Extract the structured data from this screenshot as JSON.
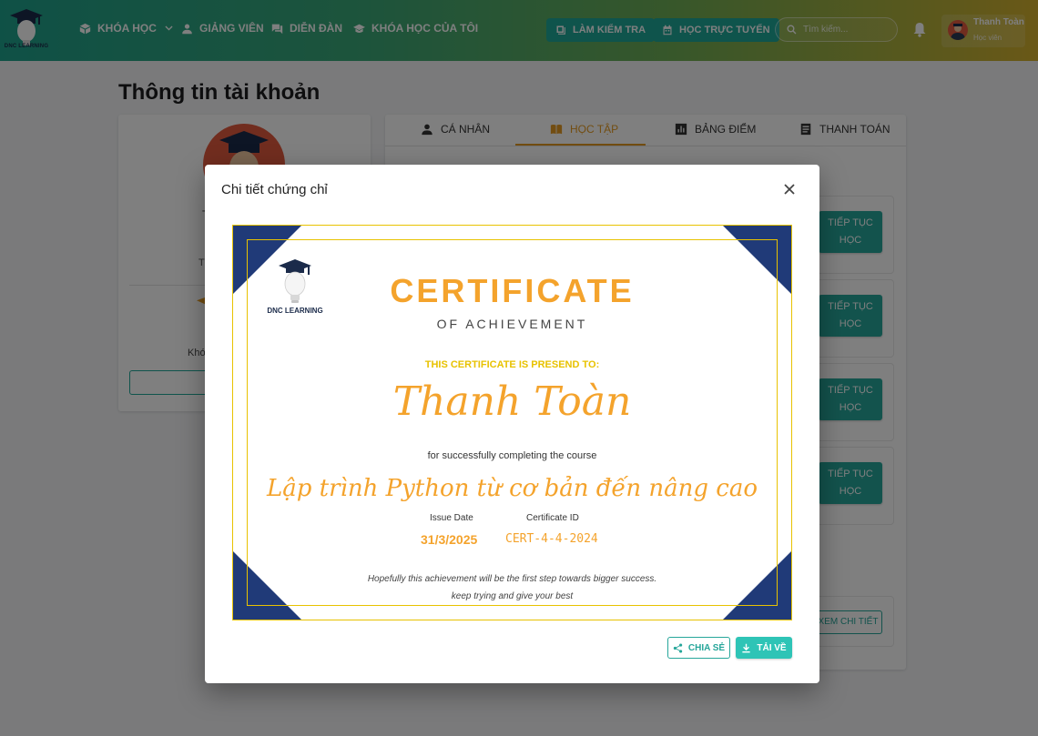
{
  "header": {
    "logo_text": "DNC LEARNING",
    "nav": {
      "courses": "KHÓA HỌC",
      "teachers": "GIẢNG VIÊN",
      "forum": "DIỄN ĐÀN",
      "my_courses": "KHÓA HỌC CỦA TÔI"
    },
    "test_button": "LÀM KIỂM TRA",
    "online_button": "HỌC TRỰC TUYẾN",
    "search_placeholder": "Tìm kiếm...",
    "user": {
      "name": "Thanh Toàn",
      "role": "Học viên"
    }
  },
  "page": {
    "title": "Thông tin tài khoản",
    "profile": {
      "name_fragment": "T",
      "role_fragment": "Th",
      "stat_fragment": "Khó"
    },
    "tabs": [
      {
        "label": "CÁ NHÂN",
        "icon": "person-icon"
      },
      {
        "label": "HỌC TẬP",
        "icon": "book-icon"
      },
      {
        "label": "BẢNG ĐIỂM",
        "icon": "bar-chart-icon"
      },
      {
        "label": "THANH TOÁN",
        "icon": "receipt-icon"
      }
    ],
    "continue_label": "TIẾP TỤC HỌC",
    "view_detail_label": "XEM CHI TIẾT"
  },
  "modal": {
    "title": "Chi tiết chứng chỉ",
    "certificate": {
      "logo_text": "DNC LEARNING",
      "heading": "CERTIFICATE",
      "subheading": "OF ACHIEVEMENT",
      "presented_to": "THIS CERTIFICATE IS PRESEND TO:",
      "recipient": "Thanh Toàn",
      "completing_text": "for successfully completing the course",
      "course_name": "Lập trình Python từ cơ bản đến nâng cao",
      "issue_date_label": "Issue Date",
      "issue_date": "31/3/2025",
      "certificate_id_label": "Certificate ID",
      "certificate_id": "CERT-4-4-2024",
      "quote_line1": "Hopefully this achievement will be the first step towards bigger success.",
      "quote_line2": "keep trying and give your best"
    },
    "share_label": "CHIA SẺ",
    "download_label": "TẢI VỀ"
  },
  "colors": {
    "accent": "#26a69a",
    "certificate_gold": "#f4a32c",
    "certificate_navy": "#203a78",
    "border_yellow": "#e8c200"
  }
}
